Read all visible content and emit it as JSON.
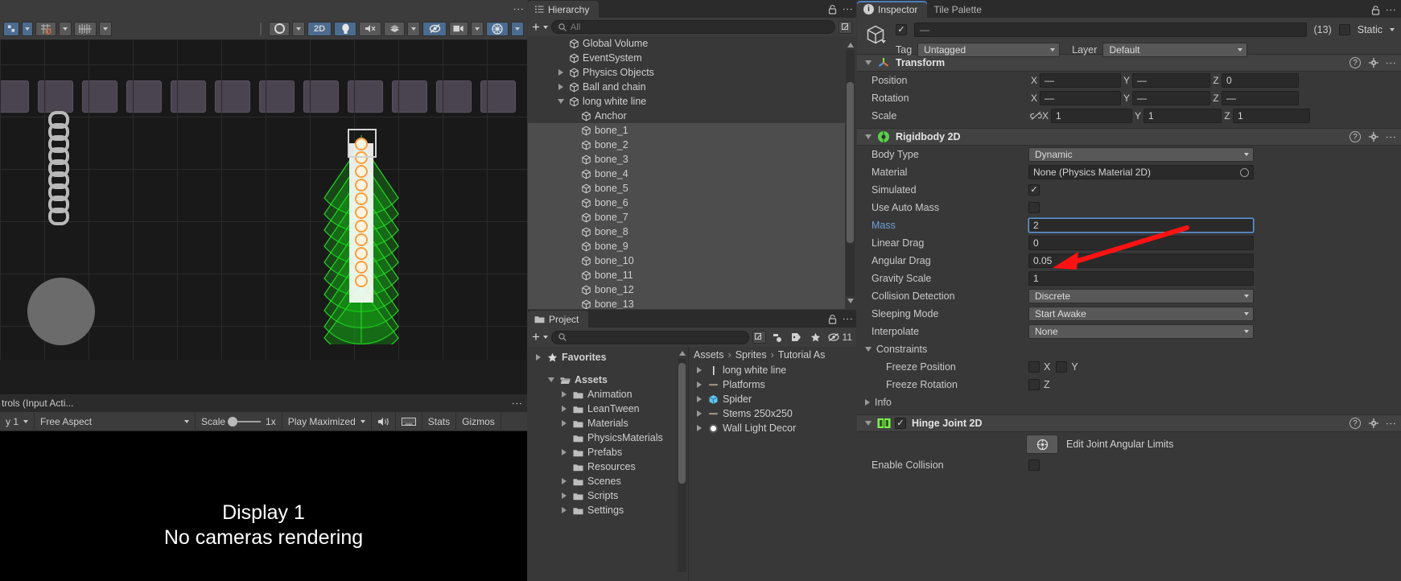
{
  "scene": {
    "toolbar_buttons": [
      "move-tool-dd",
      "grid-snap",
      "grid-snap-dd",
      "handle-snap",
      "handle-snap-dd"
    ],
    "right_buttons": [
      "shading-mode",
      "2D",
      "lighting",
      "audio",
      "effects",
      "effects-dd",
      "hidden-objects",
      "camera-view",
      "camera-dd",
      "gizmos",
      "gizmos-dd"
    ],
    "btn_2d_label": "2D",
    "overlay_menu": "⋮"
  },
  "game": {
    "tab_label": "trols (Input Acti...",
    "display_dropdown": "y 1",
    "aspect_dropdown": "Free Aspect",
    "scale_label": "Scale",
    "scale_value": "1x",
    "play_maximized": "Play Maximized",
    "mute_icon": "speaker-icon",
    "frame_debug_icon": "keyboard-icon",
    "stats_label": "Stats",
    "gizmos_label": "Gizmos",
    "canvas_line1": "Display 1",
    "canvas_line2": "No cameras rendering"
  },
  "hierarchy": {
    "tab_label": "Hierarchy",
    "add_label": "+",
    "search_placeholder": "All",
    "items": [
      {
        "label": "Global Volume",
        "indent": 2,
        "expandable": false,
        "selected": false
      },
      {
        "label": "EventSystem",
        "indent": 2,
        "expandable": false,
        "selected": false
      },
      {
        "label": "Physics Objects",
        "indent": 2,
        "expandable": true,
        "selected": false
      },
      {
        "label": "Ball and chain",
        "indent": 2,
        "expandable": true,
        "selected": false
      },
      {
        "label": "long white line",
        "indent": 2,
        "expandable": true,
        "expanded": true,
        "selected": false
      },
      {
        "label": "Anchor",
        "indent": 3,
        "expandable": false,
        "selected": false
      },
      {
        "label": "bone_1",
        "indent": 3,
        "expandable": false,
        "selected": true
      },
      {
        "label": "bone_2",
        "indent": 3,
        "expandable": false,
        "selected": true
      },
      {
        "label": "bone_3",
        "indent": 3,
        "expandable": false,
        "selected": true
      },
      {
        "label": "bone_4",
        "indent": 3,
        "expandable": false,
        "selected": true
      },
      {
        "label": "bone_5",
        "indent": 3,
        "expandable": false,
        "selected": true
      },
      {
        "label": "bone_6",
        "indent": 3,
        "expandable": false,
        "selected": true
      },
      {
        "label": "bone_7",
        "indent": 3,
        "expandable": false,
        "selected": true
      },
      {
        "label": "bone_8",
        "indent": 3,
        "expandable": false,
        "selected": true
      },
      {
        "label": "bone_9",
        "indent": 3,
        "expandable": false,
        "selected": true
      },
      {
        "label": "bone_10",
        "indent": 3,
        "expandable": false,
        "selected": true
      },
      {
        "label": "bone_11",
        "indent": 3,
        "expandable": false,
        "selected": true
      },
      {
        "label": "bone_12",
        "indent": 3,
        "expandable": false,
        "selected": true
      },
      {
        "label": "bone_13",
        "indent": 3,
        "expandable": false,
        "selected": true
      }
    ]
  },
  "project": {
    "tab_label": "Project",
    "add_label": "+",
    "search_placeholder": "",
    "hidden_count": "11",
    "favorites_label": "Favorites",
    "tree": [
      {
        "label": "Assets",
        "indent": 1,
        "expandable": true,
        "expanded": true,
        "bold": true
      },
      {
        "label": "Animation",
        "indent": 2,
        "expandable": true,
        "expanded": false,
        "bold": false
      },
      {
        "label": "LeanTween",
        "indent": 2,
        "expandable": true,
        "expanded": false,
        "bold": false
      },
      {
        "label": "Materials",
        "indent": 2,
        "expandable": true,
        "expanded": false,
        "bold": false
      },
      {
        "label": "PhysicsMaterials",
        "indent": 2,
        "expandable": false,
        "expanded": false,
        "bold": false
      },
      {
        "label": "Prefabs",
        "indent": 2,
        "expandable": true,
        "expanded": false,
        "bold": false
      },
      {
        "label": "Resources",
        "indent": 2,
        "expandable": false,
        "expanded": false,
        "bold": false
      },
      {
        "label": "Scenes",
        "indent": 2,
        "expandable": true,
        "expanded": false,
        "bold": false
      },
      {
        "label": "Scripts",
        "indent": 2,
        "expandable": true,
        "expanded": false,
        "bold": false
      },
      {
        "label": "Settings",
        "indent": 2,
        "expandable": true,
        "expanded": false,
        "bold": false
      }
    ],
    "breadcrumb": [
      "Assets",
      "Sprites",
      "Tutorial As"
    ],
    "assets": [
      {
        "label": "long white line",
        "icon": "line-icon"
      },
      {
        "label": "Platforms",
        "icon": "sprite-icon"
      },
      {
        "label": "Spider",
        "icon": "prefab-icon"
      },
      {
        "label": "Stems 250x250",
        "icon": "sprite-icon"
      },
      {
        "label": "Wall Light Decor",
        "icon": "light-icon"
      }
    ]
  },
  "inspector": {
    "tabs": [
      {
        "label": "Inspector",
        "active": true
      },
      {
        "label": "Tile Palette",
        "active": false
      }
    ],
    "object_name": "—",
    "static_count": "(13)",
    "static_label": "Static",
    "tag_label": "Tag",
    "tag_value": "Untagged",
    "layer_label": "Layer",
    "layer_value": "Default",
    "transform": {
      "title": "Transform",
      "rows": [
        {
          "label": "Position",
          "x": "—",
          "y": "—",
          "z": "0"
        },
        {
          "label": "Rotation",
          "x": "—",
          "y": "—",
          "z": "—"
        },
        {
          "label": "Scale",
          "x": "1",
          "y": "1",
          "z": "1",
          "link_icon": "broken-link-icon"
        }
      ]
    },
    "rigidbody": {
      "title": "Rigidbody 2D",
      "body_type_label": "Body Type",
      "body_type_value": "Dynamic",
      "material_label": "Material",
      "material_value": "None (Physics Material 2D)",
      "simulated_label": "Simulated",
      "simulated_checked": true,
      "use_auto_mass_label": "Use Auto Mass",
      "use_auto_mass_checked": false,
      "mass_label": "Mass",
      "mass_value": "2",
      "linear_drag_label": "Linear Drag",
      "linear_drag_value": "0",
      "angular_drag_label": "Angular Drag",
      "angular_drag_value": "0.05",
      "gravity_scale_label": "Gravity Scale",
      "gravity_scale_value": "1",
      "collision_detection_label": "Collision Detection",
      "collision_detection_value": "Discrete",
      "sleeping_mode_label": "Sleeping Mode",
      "sleeping_mode_value": "Start Awake",
      "interpolate_label": "Interpolate",
      "interpolate_value": "None",
      "constraints_label": "Constraints",
      "freeze_position_label": "Freeze Position",
      "freeze_position_x": "X",
      "freeze_position_y": "Y",
      "freeze_rotation_label": "Freeze Rotation",
      "freeze_rotation_z": "Z",
      "info_label": "Info"
    },
    "hinge": {
      "title": "Hinge Joint 2D",
      "enabled": true,
      "edit_button_label": "Edit Joint Angular Limits",
      "enable_collision_label": "Enable Collision",
      "enable_collision_checked": false
    }
  },
  "colors": {
    "accent_blue": "#4b7fbd",
    "panel_bg": "#383838",
    "header_bg": "#2b2b2b",
    "field_bg": "#2a2a2a",
    "annotation_red": "#ff1212",
    "focus_blue": "#6c9ad4",
    "mass_label_blue": "#6f9fd8"
  }
}
